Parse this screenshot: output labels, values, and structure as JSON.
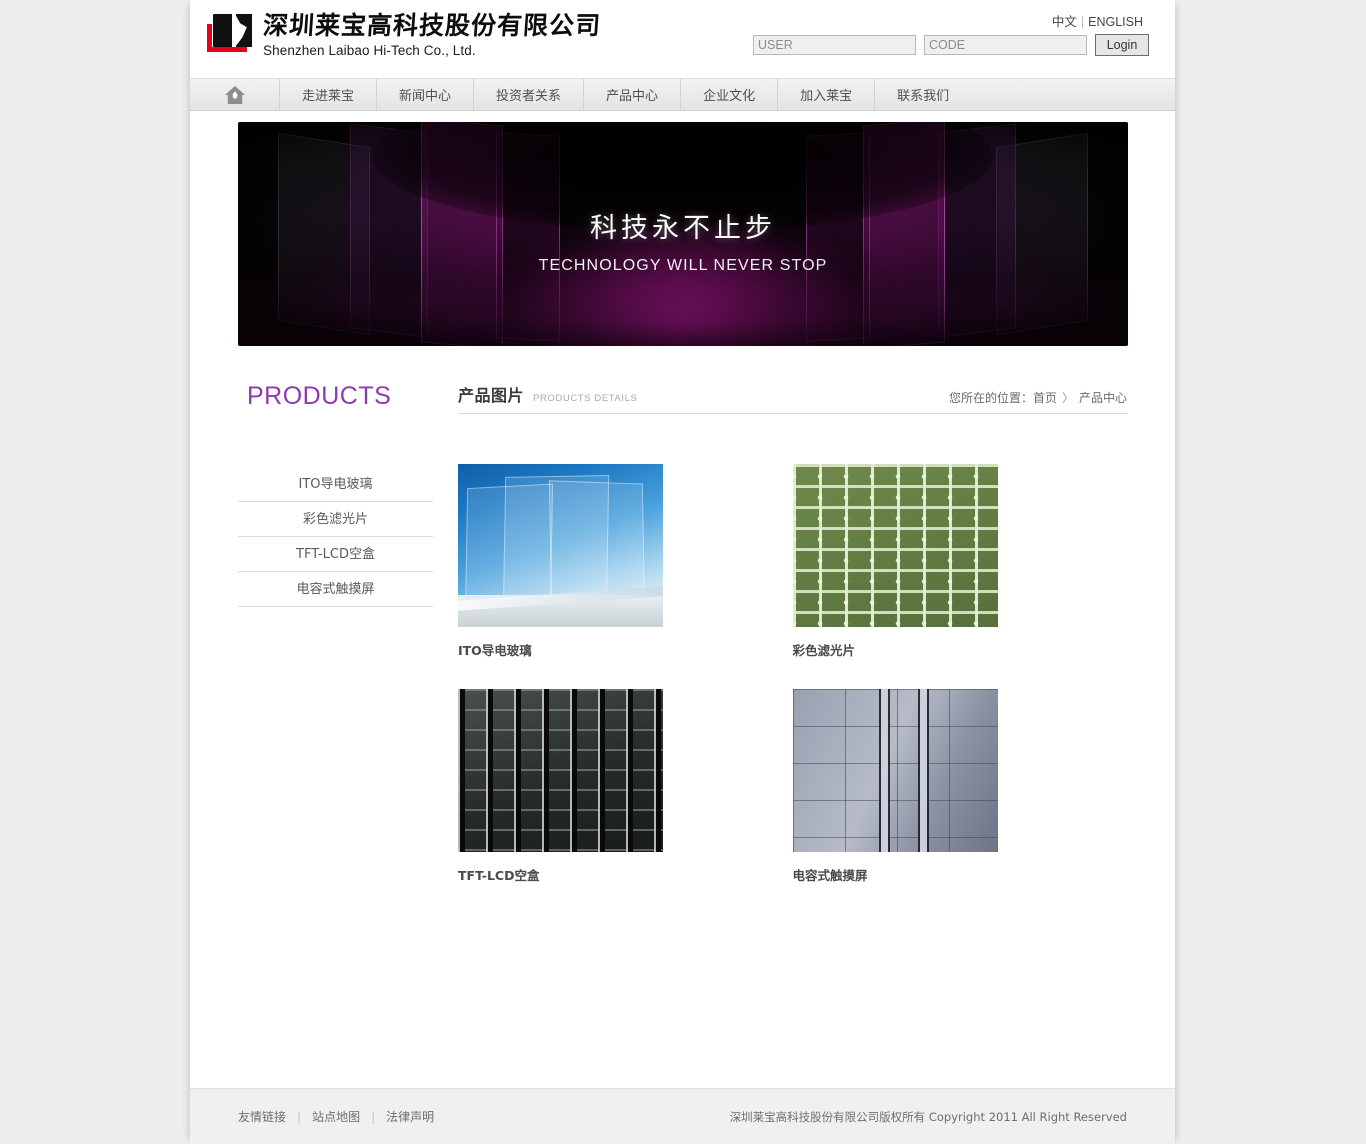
{
  "header": {
    "logo": {
      "icon": "laibao-ls-logo",
      "company_cn": "深圳莱宝高科技股份有限公司",
      "company_en": "Shenzhen Laibao Hi-Tech Co., Ltd."
    },
    "language": {
      "chinese": "中文",
      "separator": "|",
      "english": "ENGLISH"
    },
    "login": {
      "user_placeholder": "USER",
      "user_value": "",
      "code_placeholder": "CODE",
      "code_value": "",
      "button_label": "Login"
    }
  },
  "nav": {
    "home_icon": "home-icon",
    "items": [
      {
        "label": "走进莱宝"
      },
      {
        "label": "新闻中心"
      },
      {
        "label": "投资者关系"
      },
      {
        "label": "产品中心"
      },
      {
        "label": "企业文化"
      },
      {
        "label": "加入莱宝"
      },
      {
        "label": "联系我们"
      }
    ]
  },
  "banner": {
    "headline_cn": "科技永不止步",
    "headline_en": "TECHNOLOGY WILL NEVER STOP"
  },
  "sidebar": {
    "title": "PRODUCTS",
    "items": [
      {
        "label": "ITO导电玻璃"
      },
      {
        "label": "彩色滤光片"
      },
      {
        "label": "TFT-LCD空盒"
      },
      {
        "label": "电容式触摸屏"
      }
    ]
  },
  "section": {
    "title_cn": "产品图片",
    "title_en": "PRODUCTS DETAILS",
    "breadcrumb": {
      "prefix": "您所在的位置：",
      "home": "首页",
      "arrow": "〉",
      "current": "产品中心"
    }
  },
  "products": [
    {
      "label": "ITO导电玻璃",
      "art": "ito-glass-thumbnail"
    },
    {
      "label": "彩色滤光片",
      "art": "color-filter-thumbnail"
    },
    {
      "label": "TFT-LCD空盒",
      "art": "tft-lcd-cell-thumbnail"
    },
    {
      "label": "电容式触摸屏",
      "art": "capacitive-touch-panel-thumbnail"
    }
  ],
  "footer": {
    "links": [
      {
        "label": "友情链接"
      },
      {
        "label": "站点地图"
      },
      {
        "label": "法律声明"
      }
    ],
    "divider": "|",
    "copyright": "深圳莱宝高科技股份有限公司版权所有 Copyright 2011 All Right Reserved"
  },
  "colors": {
    "brand_purple": "#8e3bb0",
    "logo_red": "#e2041b",
    "banner_magenta": "#e220be",
    "page_background": "#eeeeee"
  }
}
